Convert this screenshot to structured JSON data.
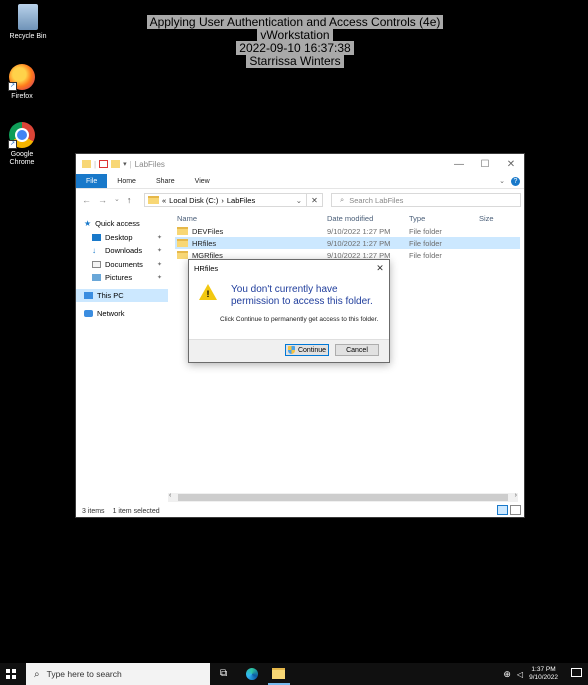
{
  "watermark": {
    "line1": "Applying User Authentication and Access Controls (4e)",
    "line2": "vWorkstation",
    "line3": "2022-09-10 16:37:38",
    "line4": "Starrissa Winters"
  },
  "desktop": {
    "icons": [
      {
        "label": "Recycle Bin",
        "icon": "recycle-bin-icon"
      },
      {
        "label": "Firefox",
        "icon": "firefox-icon"
      },
      {
        "label": "Google Chrome",
        "icon": "chrome-icon"
      }
    ]
  },
  "explorer": {
    "title": "LabFiles",
    "ribbon_tabs": [
      "File",
      "Home",
      "Share",
      "View"
    ],
    "address": {
      "crumbs": [
        "«",
        "Local Disk (C:)",
        "›",
        "LabFiles"
      ]
    },
    "search_placeholder": "Search LabFiles",
    "nav": [
      {
        "label": "Quick access"
      },
      {
        "label": "Desktop"
      },
      {
        "label": "Downloads"
      },
      {
        "label": "Documents"
      },
      {
        "label": "Pictures"
      },
      {
        "label": "This PC"
      },
      {
        "label": "Network"
      }
    ],
    "columns": [
      "Name",
      "Date modified",
      "Type",
      "Size"
    ],
    "rows": [
      {
        "name": "DEVFiles",
        "date": "9/10/2022 1:27 PM",
        "type": "File folder",
        "size": ""
      },
      {
        "name": "HRfiles",
        "date": "9/10/2022 1:27 PM",
        "type": "File folder",
        "size": ""
      },
      {
        "name": "MGRfiles",
        "date": "9/10/2022 1:27 PM",
        "type": "File folder",
        "size": ""
      }
    ],
    "status": {
      "items": "3 items",
      "selected": "1 item selected"
    }
  },
  "dialog": {
    "title": "HRfiles",
    "main": "You don't currently have permission to access this folder.",
    "sub": "Click Continue to permanently get access to this folder.",
    "continue_label": "Continue",
    "cancel_label": "Cancel"
  },
  "taskbar": {
    "search_placeholder": "Type here to search",
    "time": "1:37 PM",
    "date": "9/10/2022"
  },
  "colors": {
    "accent": "#1979ca",
    "selection": "#cce8ff",
    "warning": "#f2c811"
  }
}
